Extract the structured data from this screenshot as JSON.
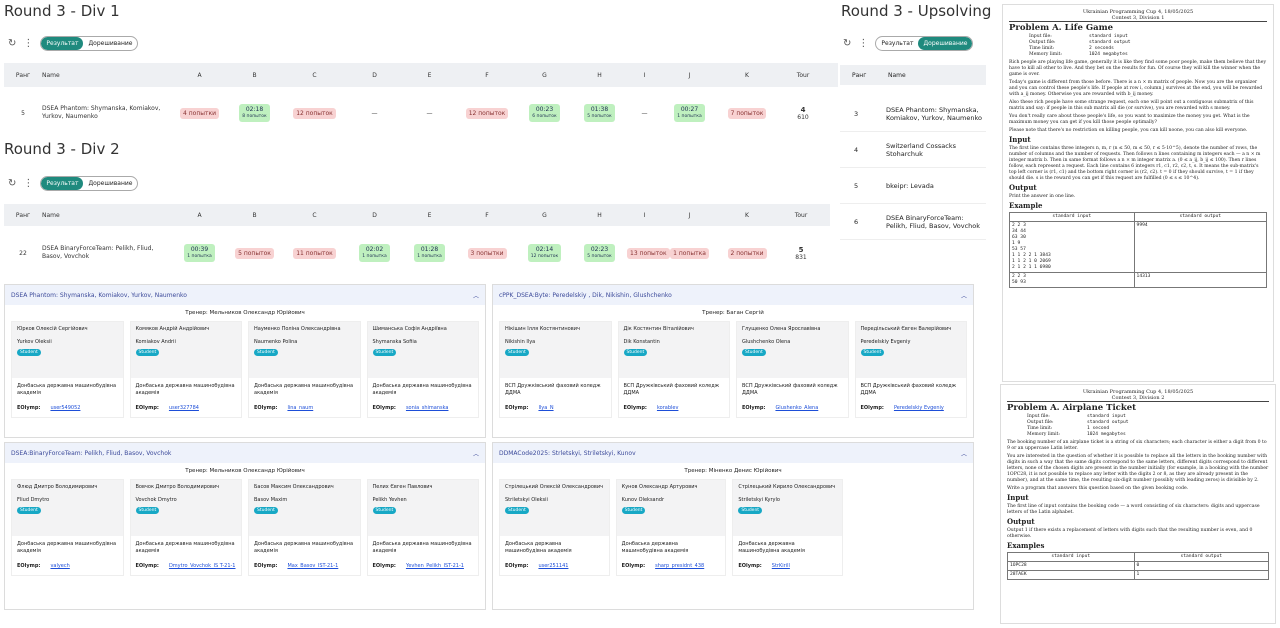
{
  "div1": {
    "title": "Round 3 - Div 1",
    "tab_result": "Результат",
    "tab_extra": "Дорешивание",
    "cols": [
      "Ранг",
      "Name",
      "A",
      "B",
      "C",
      "D",
      "E",
      "F",
      "G",
      "H",
      "I",
      "J",
      "K",
      "Tour"
    ],
    "row": {
      "rank": "5",
      "team": "DSEA Phantom: Shymanska, Komiakov, Yurkov, Naumenko",
      "tour1": "4",
      "tour2": "610",
      "cells": [
        {
          "k": "bad",
          "t": "4 попытки",
          "s": ""
        },
        {
          "k": "ok",
          "t": "02:18",
          "s": "8 попыток"
        },
        {
          "k": "bad",
          "t": "12 попыток",
          "s": ""
        },
        {
          "k": "none",
          "t": "—",
          "s": ""
        },
        {
          "k": "none",
          "t": "—",
          "s": ""
        },
        {
          "k": "bad",
          "t": "12 попыток",
          "s": ""
        },
        {
          "k": "ok",
          "t": "00:23",
          "s": "6 попыток"
        },
        {
          "k": "ok",
          "t": "01:38",
          "s": "5 попыток"
        },
        {
          "k": "none",
          "t": "—",
          "s": ""
        },
        {
          "k": "ok",
          "t": "00:27",
          "s": "1 попытка"
        },
        {
          "k": "bad",
          "t": "7 попыток",
          "s": ""
        }
      ]
    }
  },
  "div2": {
    "title": "Round 3 - Div 2",
    "tab_result": "Результат",
    "tab_extra": "Дорешивание",
    "cols": [
      "Ранг",
      "Name",
      "A",
      "B",
      "C",
      "D",
      "E",
      "F",
      "G",
      "H",
      "I",
      "J",
      "K",
      "Tour"
    ],
    "row": {
      "rank": "22",
      "team": "DSEA BinaryForceTeam: Pelikh, Fliud, Basov, Vovchok",
      "tour1": "5",
      "tour2": "831",
      "cells": [
        {
          "k": "ok",
          "t": "00:39",
          "s": "1 попытка"
        },
        {
          "k": "bad",
          "t": "5 попыток",
          "s": ""
        },
        {
          "k": "bad",
          "t": "11 попыток",
          "s": ""
        },
        {
          "k": "ok",
          "t": "02:02",
          "s": "1 попытка"
        },
        {
          "k": "ok",
          "t": "01:28",
          "s": "1 попытка"
        },
        {
          "k": "bad",
          "t": "3 попытки",
          "s": ""
        },
        {
          "k": "ok",
          "t": "02:14",
          "s": "12 попыток"
        },
        {
          "k": "ok",
          "t": "02:23",
          "s": "5 попыток"
        },
        {
          "k": "bad",
          "t": "13 попыток",
          "s": ""
        },
        {
          "k": "bad",
          "t": "1 попытка",
          "s": ""
        },
        {
          "k": "bad",
          "t": "2 попытки",
          "s": ""
        }
      ]
    }
  },
  "upsolve": {
    "title": "Round 3 - Upsolving",
    "tab_result": "Результат",
    "tab_extra": "Дорешивание",
    "col_rank": "Ранг",
    "col_name": "Name",
    "rows": [
      {
        "r": "3",
        "n": "DSEA Phantom: Shymanska, Komiakov, Yurkov, Naumenko"
      },
      {
        "r": "4",
        "n": "Switzerland Cossacks Stoharchuk"
      },
      {
        "r": "5",
        "n": "bkeipr: Levada"
      },
      {
        "r": "6",
        "n": "DSEA BinaryForceTeam: Pelikh, Fliud, Basov, Vovchok"
      }
    ]
  },
  "teams": [
    {
      "name": "DSEA Phantom: Shymanska, Komiakov, Yurkov, Naumenko",
      "coach": "Тренер: Мельников Олександр Юрійович",
      "members": [
        {
          "ua": "Юрков Олексій Сергійович",
          "en": "Yurkov Oleksii",
          "badge": "Student",
          "uni": "Донбаська державна машинобудівна академія",
          "eo_label": "EOlymp:",
          "eo": "user549052"
        },
        {
          "ua": "Комяков Андрій Андрійович",
          "en": "Komiakov Andrii",
          "badge": "Student",
          "uni": "Донбаська державна машинобудівна академія",
          "eo_label": "EOlymp:",
          "eo": "user327784"
        },
        {
          "ua": "Науменко Поліна Олександрівна",
          "en": "Naumenko Polina",
          "badge": "Student",
          "uni": "Донбаська державна машинобудівна академія",
          "eo_label": "EOlymp:",
          "eo": "lina_naum"
        },
        {
          "ua": "Шиманська Софія Андріївна",
          "en": "Shymanska Sofiia",
          "badge": "Student",
          "uni": "Донбаська державна машинобудівна академія",
          "eo_label": "EOlymp:",
          "eo": "sonia_shimanska"
        }
      ]
    },
    {
      "name": "cPPK_DSEA:Byte: Peredelskiy , Dik, Nikishin, Glushchenko",
      "coach": "Тренер: Баган Сергій",
      "members": [
        {
          "ua": "Нікішин Ілля Костянтинович",
          "en": "Nikishin Ilya",
          "badge": "Student",
          "uni": "ВСП Дружківський фаховий коледж ДДМА",
          "eo_label": "EOlymp:",
          "eo": "Ilya_N"
        },
        {
          "ua": "Дік Костянтин Віталійович",
          "en": "Dik Konstantin",
          "badge": "Student",
          "uni": "ВСП Дружківський фаховий коледж ДДМА",
          "eo_label": "EOlymp:",
          "eo": "korablev"
        },
        {
          "ua": "Глущенко Олена Ярославівна",
          "en": "Glushchenko Olena",
          "badge": "Student",
          "uni": "ВСП Дружківський фаховий коледж ДДМА",
          "eo_label": "EOlymp:",
          "eo": "Glushenko_Alena"
        },
        {
          "ua": "Передільський Євген Валерійович",
          "en": "Peredelskiy Evgeniy",
          "badge": "Student",
          "uni": "ВСП Дружківський фаховий коледж ДДМА",
          "eo_label": "EOlymp:",
          "eo": "Peredelskiy Evgeniy"
        }
      ]
    },
    {
      "name": "DSEA:BinaryForceTeam: Pelikh, Fliud, Basov, Vovchok",
      "coach": "Тренер: Мельников Олександр Юрійович",
      "members": [
        {
          "ua": "Флюд Дмитро Володимирович",
          "en": "Fliud Dmytro",
          "badge": "Student",
          "uni": "Донбаська державна машинобудівна академія",
          "eo_label": "EOlymp:",
          "eo": "valyech"
        },
        {
          "ua": "Вовчок Дмитро Володимирович",
          "en": "Vovchok Dmytro",
          "badge": "Student",
          "uni": "Донбаська державна машинобудівна академія",
          "eo_label": "EOlymp:",
          "eo": "Dmytro_Vovchok_IS T-21-1"
        },
        {
          "ua": "Басов Максим Олександрович",
          "en": "Basov Maxim",
          "badge": "Student",
          "uni": "Донбаська державна машинобудівна академія",
          "eo_label": "EOlymp:",
          "eo": "Max_Basov_IST-21-1"
        },
        {
          "ua": "Пелих Євген Павлович",
          "en": "Pelikh Yevhen",
          "badge": "Student",
          "uni": "Донбаська державна машинобудівна академія",
          "eo_label": "EOlymp:",
          "eo": "Yevhen_Pelikh_IST-21-1"
        }
      ]
    },
    {
      "name": "DDMACode2025: Strletskyi, Striletskyi, Kunov",
      "coach": "Тренер: Міненко Денис Юрійович",
      "members": [
        {
          "ua": "Стрілецький Олексій Олександрович",
          "en": "Striletskyi Oleksii",
          "badge": "Student",
          "uni": "Донбаська державна машинобудівна академія",
          "eo_label": "EOlymp:",
          "eo": "user251141"
        },
        {
          "ua": "Кунов Олександр Артурович",
          "en": "Kunov Oleksandr",
          "badge": "Student",
          "uni": "Донбаська державна машинобудівна академія",
          "eo_label": "EOlymp:",
          "eo": "sharp_presidnt_438"
        },
        {
          "ua": "Стрілецький Кирило Олександрович",
          "en": "Striletskyi Kyrylo",
          "badge": "Student",
          "uni": "Донбаська державна машинобудівна академія",
          "eo_label": "EOlymp:",
          "eo": "StrKirill"
        }
      ]
    }
  ],
  "pdf1": {
    "header1": "Ukrainian Programming Cup 4, 18/05/2025",
    "header2": "Contest 3, Division 1",
    "title": "Problem A. Life Game",
    "meta": [
      "Input file:",
      "standard input",
      "Output file:",
      "standard output",
      "Time limit:",
      "2 seconds",
      "Memory limit:",
      "1024 megabytes"
    ],
    "body": [
      "Rich people are playing life game, generally it is like they find some poor people, make them believe that they have to kill all other to live. And they bet on the results for fun. Of course they will kill the winner when the game is over.",
      "Today's game is different from those before. There is a n × m matrix of people. Now you are the organizer and you can control these people's life. If people at row i, column j survives at the end, you will be rewarded with a_ij money. Otherwise you are rewarded with b_ij money.",
      "Also these rich people have some strange request, each one will point out a contiguous submatrix of this matrix and say: if people in this sub matrix all die (or survive), you are rewarded with s money.",
      "You don't really care about those people's life, so you want to maximize the money you get. What is the maximum money you can get if you kill those people optimally?",
      "Please note that there's no restriction on killing people, you can kill noone, you can also kill everyone."
    ],
    "input_h": "Input",
    "input": "The first line contains three integers n, m, r (n ≤ 50, m ≤ 50, r ≤ 5·10^5), denote the number of rows, the number of columns and the number of requests. Then follows n lines containing m integers each — a n × m integer matrix b. Then in same format follows a n × m integer matrix a. (0 ≤ a_ij, b_ij ≤ 100). Then r lines follow, each represent a request. Each line contains 6 integers r1, c1, r2, c2, t, s. It means the sub-matrix's top left corner is (r1, c1) and the bottom right corner is (r2, c2). t = 0 if they should survive, t = 1 if they should die. s is the reward you can get if this request are fulfilled (0 ≤ s ≤ 10^4).",
    "output_h": "Output",
    "output": "Print the answer in one line.",
    "example_h": "Example",
    "ex_in_h": "standard input",
    "ex_out_h": "standard output",
    "ex_in": "2 2 3\n34 44\n63 30\n1 9\n53 57\n1 1 2 2 1 3843\n1 1 2 1 0 2069\n2 1 2 1 1 6980",
    "ex_out": "9994",
    "ex_in2": "2 2 3\n50 93",
    "ex_out2": "14313"
  },
  "pdf2": {
    "header1": "Ukrainian Programming Cup 4, 18/05/2025",
    "header2": "Contest 3, Division 2",
    "title": "Problem A. Airplane Ticket",
    "meta": [
      "Input file:",
      "standard input",
      "Output file:",
      "standard output",
      "Time limit:",
      "1 second",
      "Memory limit:",
      "1024 megabytes"
    ],
    "body": [
      "The booking number of an airplane ticket is a string of six characters; each character is either a digit from 0 to 9 or an uppercase Latin letter.",
      "You are interested in the question of whether it is possible to replace all the letters in the booking number with digits in such a way that the same digits correspond to the same letters, different digits correspond to different letters, none of the chosen digits are present in the number initially (for example, in a booking with the number 1OPC28, it is not possible to replace any letter with the digits 2 or 8, as they are already present in the number), and at the same time, the resulting six-digit number (possibly with leading zeros) is divisible by 2.",
      "Write a program that answers this question based on the given booking code."
    ],
    "input_h": "Input",
    "input": "The first line of input contains the booking code — a word consisting of six characters: digits and uppercase letters of the Latin alphabet.",
    "output_h": "Output",
    "output": "Output 1 if there exists a replacement of letters with digits such that the resulting number is even, and 0 otherwise.",
    "examples_h": "Examples",
    "ex_in_h": "standard input",
    "ex_out_h": "standard output",
    "examples": [
      {
        "i": "1OPC28",
        "o": "0"
      },
      {
        "i": "28TAEK",
        "o": "1"
      }
    ]
  }
}
